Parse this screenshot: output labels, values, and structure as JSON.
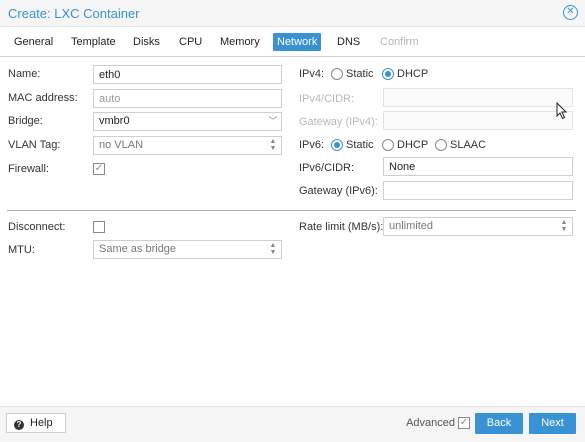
{
  "window": {
    "title": "Create: LXC Container"
  },
  "tabs": [
    {
      "label": "General"
    },
    {
      "label": "Template"
    },
    {
      "label": "Disks"
    },
    {
      "label": "CPU"
    },
    {
      "label": "Memory"
    },
    {
      "label": "Network",
      "active": true
    },
    {
      "label": "DNS"
    },
    {
      "label": "Confirm",
      "disabled": true
    }
  ],
  "form": {
    "name": {
      "label": "Name:",
      "value": "eth0"
    },
    "mac": {
      "label": "MAC address:",
      "placeholder": "auto"
    },
    "bridge": {
      "label": "Bridge:",
      "value": "vmbr0"
    },
    "vlan": {
      "label": "VLAN Tag:",
      "placeholder": "no VLAN"
    },
    "firewall": {
      "label": "Firewall:",
      "checked": true
    },
    "ipv4": {
      "label": "IPv4:",
      "options": [
        "Static",
        "DHCP"
      ],
      "selected": "DHCP"
    },
    "ipv4_cidr": {
      "label": "IPv4/CIDR:",
      "value": ""
    },
    "gateway4": {
      "label": "Gateway (IPv4):",
      "value": ""
    },
    "ipv6": {
      "label": "IPv6:",
      "options": [
        "Static",
        "DHCP",
        "SLAAC"
      ],
      "selected": "Static"
    },
    "ipv6_cidr": {
      "label": "IPv6/CIDR:",
      "value": "None"
    },
    "gateway6": {
      "label": "Gateway (IPv6):",
      "value": ""
    },
    "disconnect": {
      "label": "Disconnect:",
      "checked": false
    },
    "mtu": {
      "label": "MTU:",
      "placeholder": "Same as bridge"
    },
    "rate": {
      "label": "Rate limit (MB/s):",
      "placeholder": "unlimited"
    }
  },
  "footer": {
    "help_label": "Help",
    "advanced_label": "Advanced",
    "advanced_checked": true,
    "back_label": "Back",
    "next_label": "Next"
  },
  "colors": {
    "accent": "#3892d4",
    "title": "#3892d4"
  }
}
